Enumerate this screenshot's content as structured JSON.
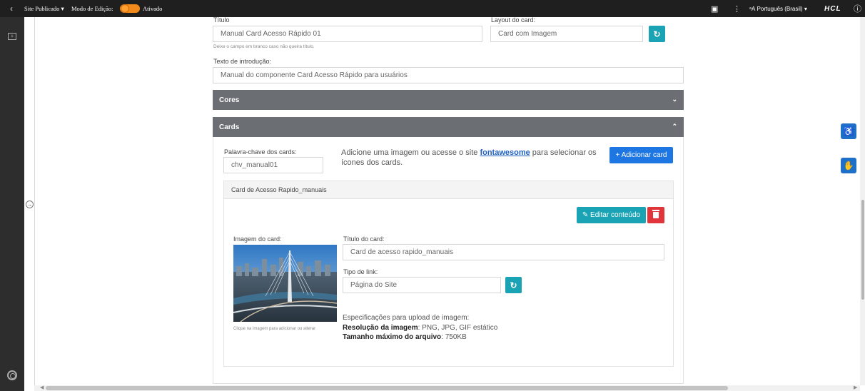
{
  "topbar": {
    "back_icon": "chevron-left-icon",
    "site_status": "Site Publicado",
    "site_status_caret": "▾",
    "edit_mode_label": "Modo de Edição:",
    "edit_mode_state": "Ativado",
    "language": "Português (Brasil)",
    "language_caret": "▾",
    "brand": "HCL"
  },
  "form": {
    "title_label": "Título",
    "title_value": "Manual Card Acesso Rápido 01",
    "title_hint": "Deixe o campo em branco caso não queira título.",
    "layout_label": "Layout do card:",
    "layout_value": "Card com Imagem",
    "intro_label": "Texto de introdução:",
    "intro_value": "Manual do componente Card Acesso Rápido para usuários"
  },
  "panels": {
    "cores_title": "Cores",
    "cards_title": "Cards"
  },
  "cards": {
    "keyword_label": "Palavra-chave dos cards:",
    "keyword_value": "chv_manual01",
    "intro_before": "Adicione uma imagem ou acesse o site ",
    "intro_link": "fontawesome",
    "intro_after": " para selecionar os ícones dos cards.",
    "add_button": "+ Adicionar card",
    "item": {
      "header": "Card de Acesso Rapido_manuais",
      "edit_button": "Editar conteúdo",
      "image_label": "Imagem do card:",
      "image_hint": "Clique na imagem para adicionar ou alterar",
      "card_title_label": "Título do card:",
      "card_title_value": "Card de acesso rapido_manuais",
      "link_type_label": "Tipo de link:",
      "link_type_value": "Página do Site",
      "spec_heading": "Especificações para upload de imagem:",
      "spec_resolution_label": "Resolução da imagem",
      "spec_resolution_value": ": PNG, JPG, GIF estático",
      "spec_size_label": "Tamanho máximo do arquivo",
      "spec_size_value": ": 750KB"
    }
  },
  "colors": {
    "topbar": "#1f1f1f",
    "toggle": "#f28a1b",
    "panel_header": "#6b6e73",
    "teal": "#1aa3b4",
    "blue": "#1e76e3",
    "red": "#e0363b"
  }
}
